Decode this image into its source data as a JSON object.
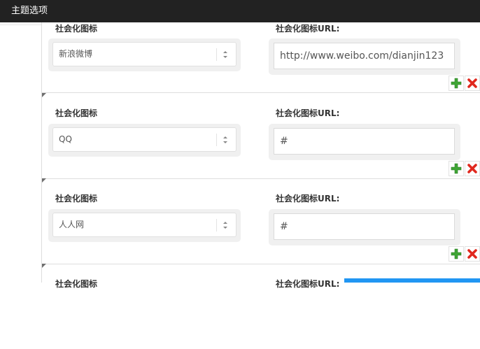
{
  "header": {
    "title": "主题选项"
  },
  "rows": [
    {
      "icon_label": "社会化图标",
      "url_label": "社会化图标URL:",
      "select_value": "新浪微博",
      "url_value": "http://www.weibo.com/dianjin123"
    },
    {
      "icon_label": "社会化图标",
      "url_label": "社会化图标URL:",
      "select_value": "QQ",
      "url_value": "#"
    },
    {
      "icon_label": "社会化图标",
      "url_label": "社会化图标URL:",
      "select_value": "人人网",
      "url_value": "#"
    },
    {
      "icon_label": "社会化图标",
      "url_label": "社会化图标URL:"
    }
  ],
  "colors": {
    "topbar": "#222222",
    "add_green": "#3fa535",
    "delete_red": "#e0281e",
    "accent_blue": "#2196f3"
  },
  "icons": {
    "add": "plus-icon",
    "delete": "close-icon",
    "select": "select-arrows-icon"
  }
}
